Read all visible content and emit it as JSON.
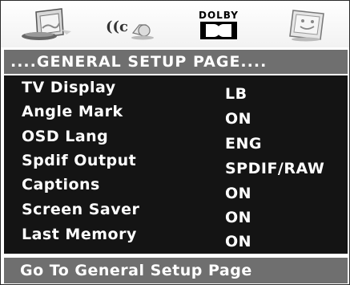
{
  "icons": [
    {
      "name": "general-setup-icon"
    },
    {
      "name": "audio-setup-icon",
      "text": "((c"
    },
    {
      "name": "dolby-setup-icon",
      "text": "DOLBY"
    },
    {
      "name": "preference-setup-icon"
    }
  ],
  "page_title": "....GENERAL SETUP PAGE....",
  "menu": [
    {
      "label": "TV Display",
      "value": "LB"
    },
    {
      "label": "Angle Mark",
      "value": "ON"
    },
    {
      "label": "OSD Lang",
      "value": "ENG"
    },
    {
      "label": "Spdif Output",
      "value": "SPDIF/RAW"
    },
    {
      "label": "Captions",
      "value": "ON"
    },
    {
      "label": "Screen Saver",
      "value": "ON"
    },
    {
      "label": "Last Memory",
      "value": "ON"
    }
  ],
  "status": "Go To General Setup Page",
  "colors": {
    "bar": "#6f6f6f",
    "menu_bg": "#141414",
    "text": "#ffffff"
  }
}
